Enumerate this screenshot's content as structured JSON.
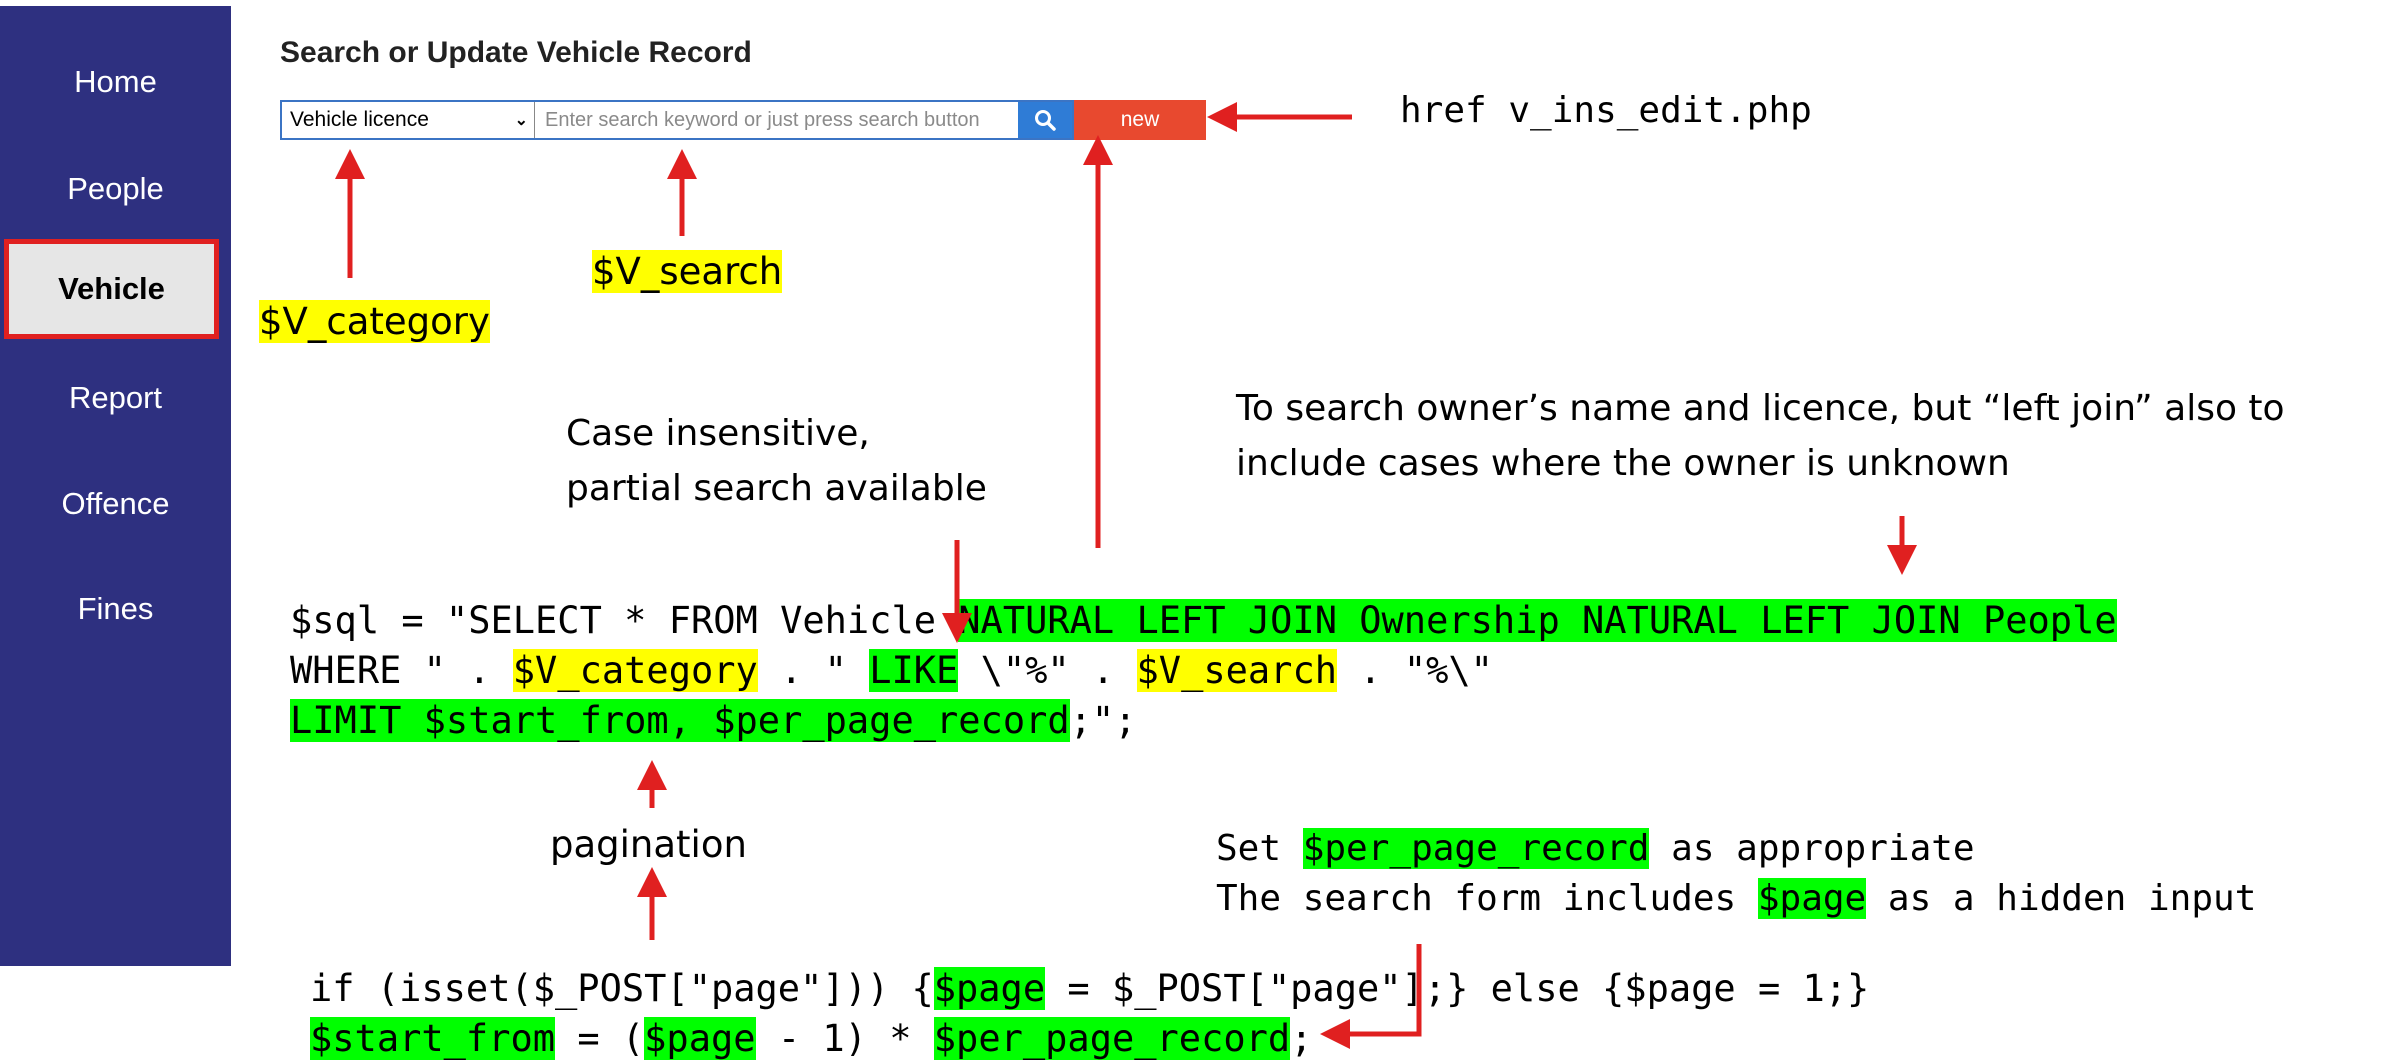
{
  "sidebar": {
    "items": [
      {
        "label": "Home",
        "active": false
      },
      {
        "label": "People",
        "active": false
      },
      {
        "label": "Vehicle",
        "active": true
      },
      {
        "label": "Report",
        "active": false
      },
      {
        "label": "Offence",
        "active": false
      },
      {
        "label": "Fines",
        "active": false
      }
    ]
  },
  "form": {
    "title": "Search or Update Vehicle Record",
    "category_selected": "Vehicle licence",
    "search_placeholder": "Enter search keyword or just press search button",
    "search_value": "",
    "new_label": "new"
  },
  "annotations": {
    "href_note": "href v_ins_edit.php",
    "v_category": "$V_category",
    "v_search": "$V_search",
    "case_note_1": "Case insensitive,",
    "case_note_2": "partial search available",
    "owner_note_1": "To search owner’s name and licence, but “left join” also to",
    "owner_note_2": "include cases where the owner is unknown",
    "pagination": "pagination",
    "set_note_prefix": "Set ",
    "set_note_var": "$per_page_record",
    "set_note_suffix": " as appropriate",
    "hidden_prefix": "The search form includes ",
    "hidden_var": "$page",
    "hidden_suffix": " as a hidden input"
  },
  "sql_code": {
    "l1a": "$sql = \"SELECT * FROM Vehicle ",
    "l1b": "NATURAL LEFT JOIN Ownership NATURAL LEFT JOIN People",
    "l2a": "WHERE \" . ",
    "l2b": "$V_category",
    "l2c": " . \" ",
    "l2d": "LIKE",
    "l2e": " \\\"%\" . ",
    "l2f": "$V_search",
    "l2g": " . \"%\\\"",
    "l3a": "LIMIT $start_from, $per_page_record",
    "l3b": ";\";"
  },
  "page_code": {
    "l1a": "if (isset($_POST[\"page\"])) {",
    "l1b": "$page",
    "l1c": " = $_POST[\"page\"];} else {$page = 1;}",
    "l2a": "$start_from",
    "l2b": " = (",
    "l2c": "$page",
    "l2d": " - 1) * ",
    "l2e": "$per_page_record",
    "l2f": ";"
  },
  "colors": {
    "sidebar": "#2e3080",
    "highlight_yellow": "#ffff00",
    "highlight_green": "#00ff00",
    "arrow": "#e02020",
    "search_button": "#2f7cd6",
    "new_button": "#e8492f"
  },
  "icons": {
    "search": "search-icon",
    "dropdown": "chevron-down-icon"
  }
}
